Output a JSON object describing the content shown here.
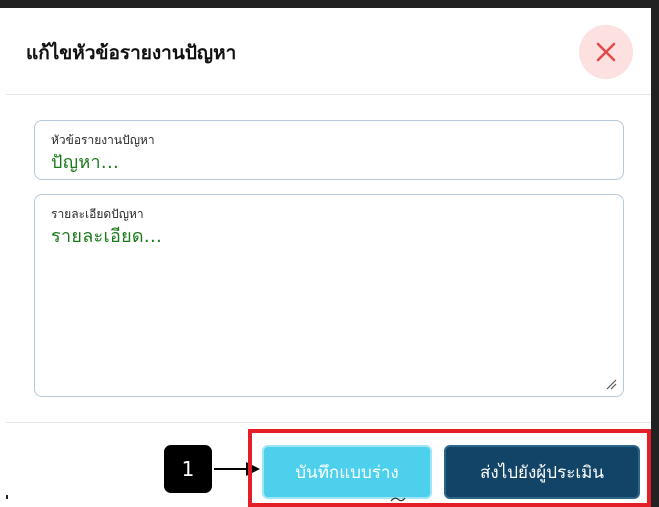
{
  "modal": {
    "title": "แก้ไขหัวข้อรายงานปัญหา",
    "close_icon": "close-x-icon"
  },
  "fields": {
    "subject": {
      "label": "หัวข้อรายงานปัญหา",
      "value": "ปัญหา..."
    },
    "detail": {
      "label": "รายละเอียดปัญหา",
      "value": "รายละเอียด..."
    }
  },
  "footer": {
    "step_badge": "1",
    "save_draft_label": "บันทึกแบบร่าง",
    "send_label": "ส่งไปยังผู้ประเมิน"
  },
  "colors": {
    "close_bg": "#fde0e0",
    "close_x": "#e24b4b",
    "value_text": "#1a7a1a",
    "draft_button": "#4cd0ec",
    "send_button": "#114466",
    "highlight": "#e41e26"
  }
}
